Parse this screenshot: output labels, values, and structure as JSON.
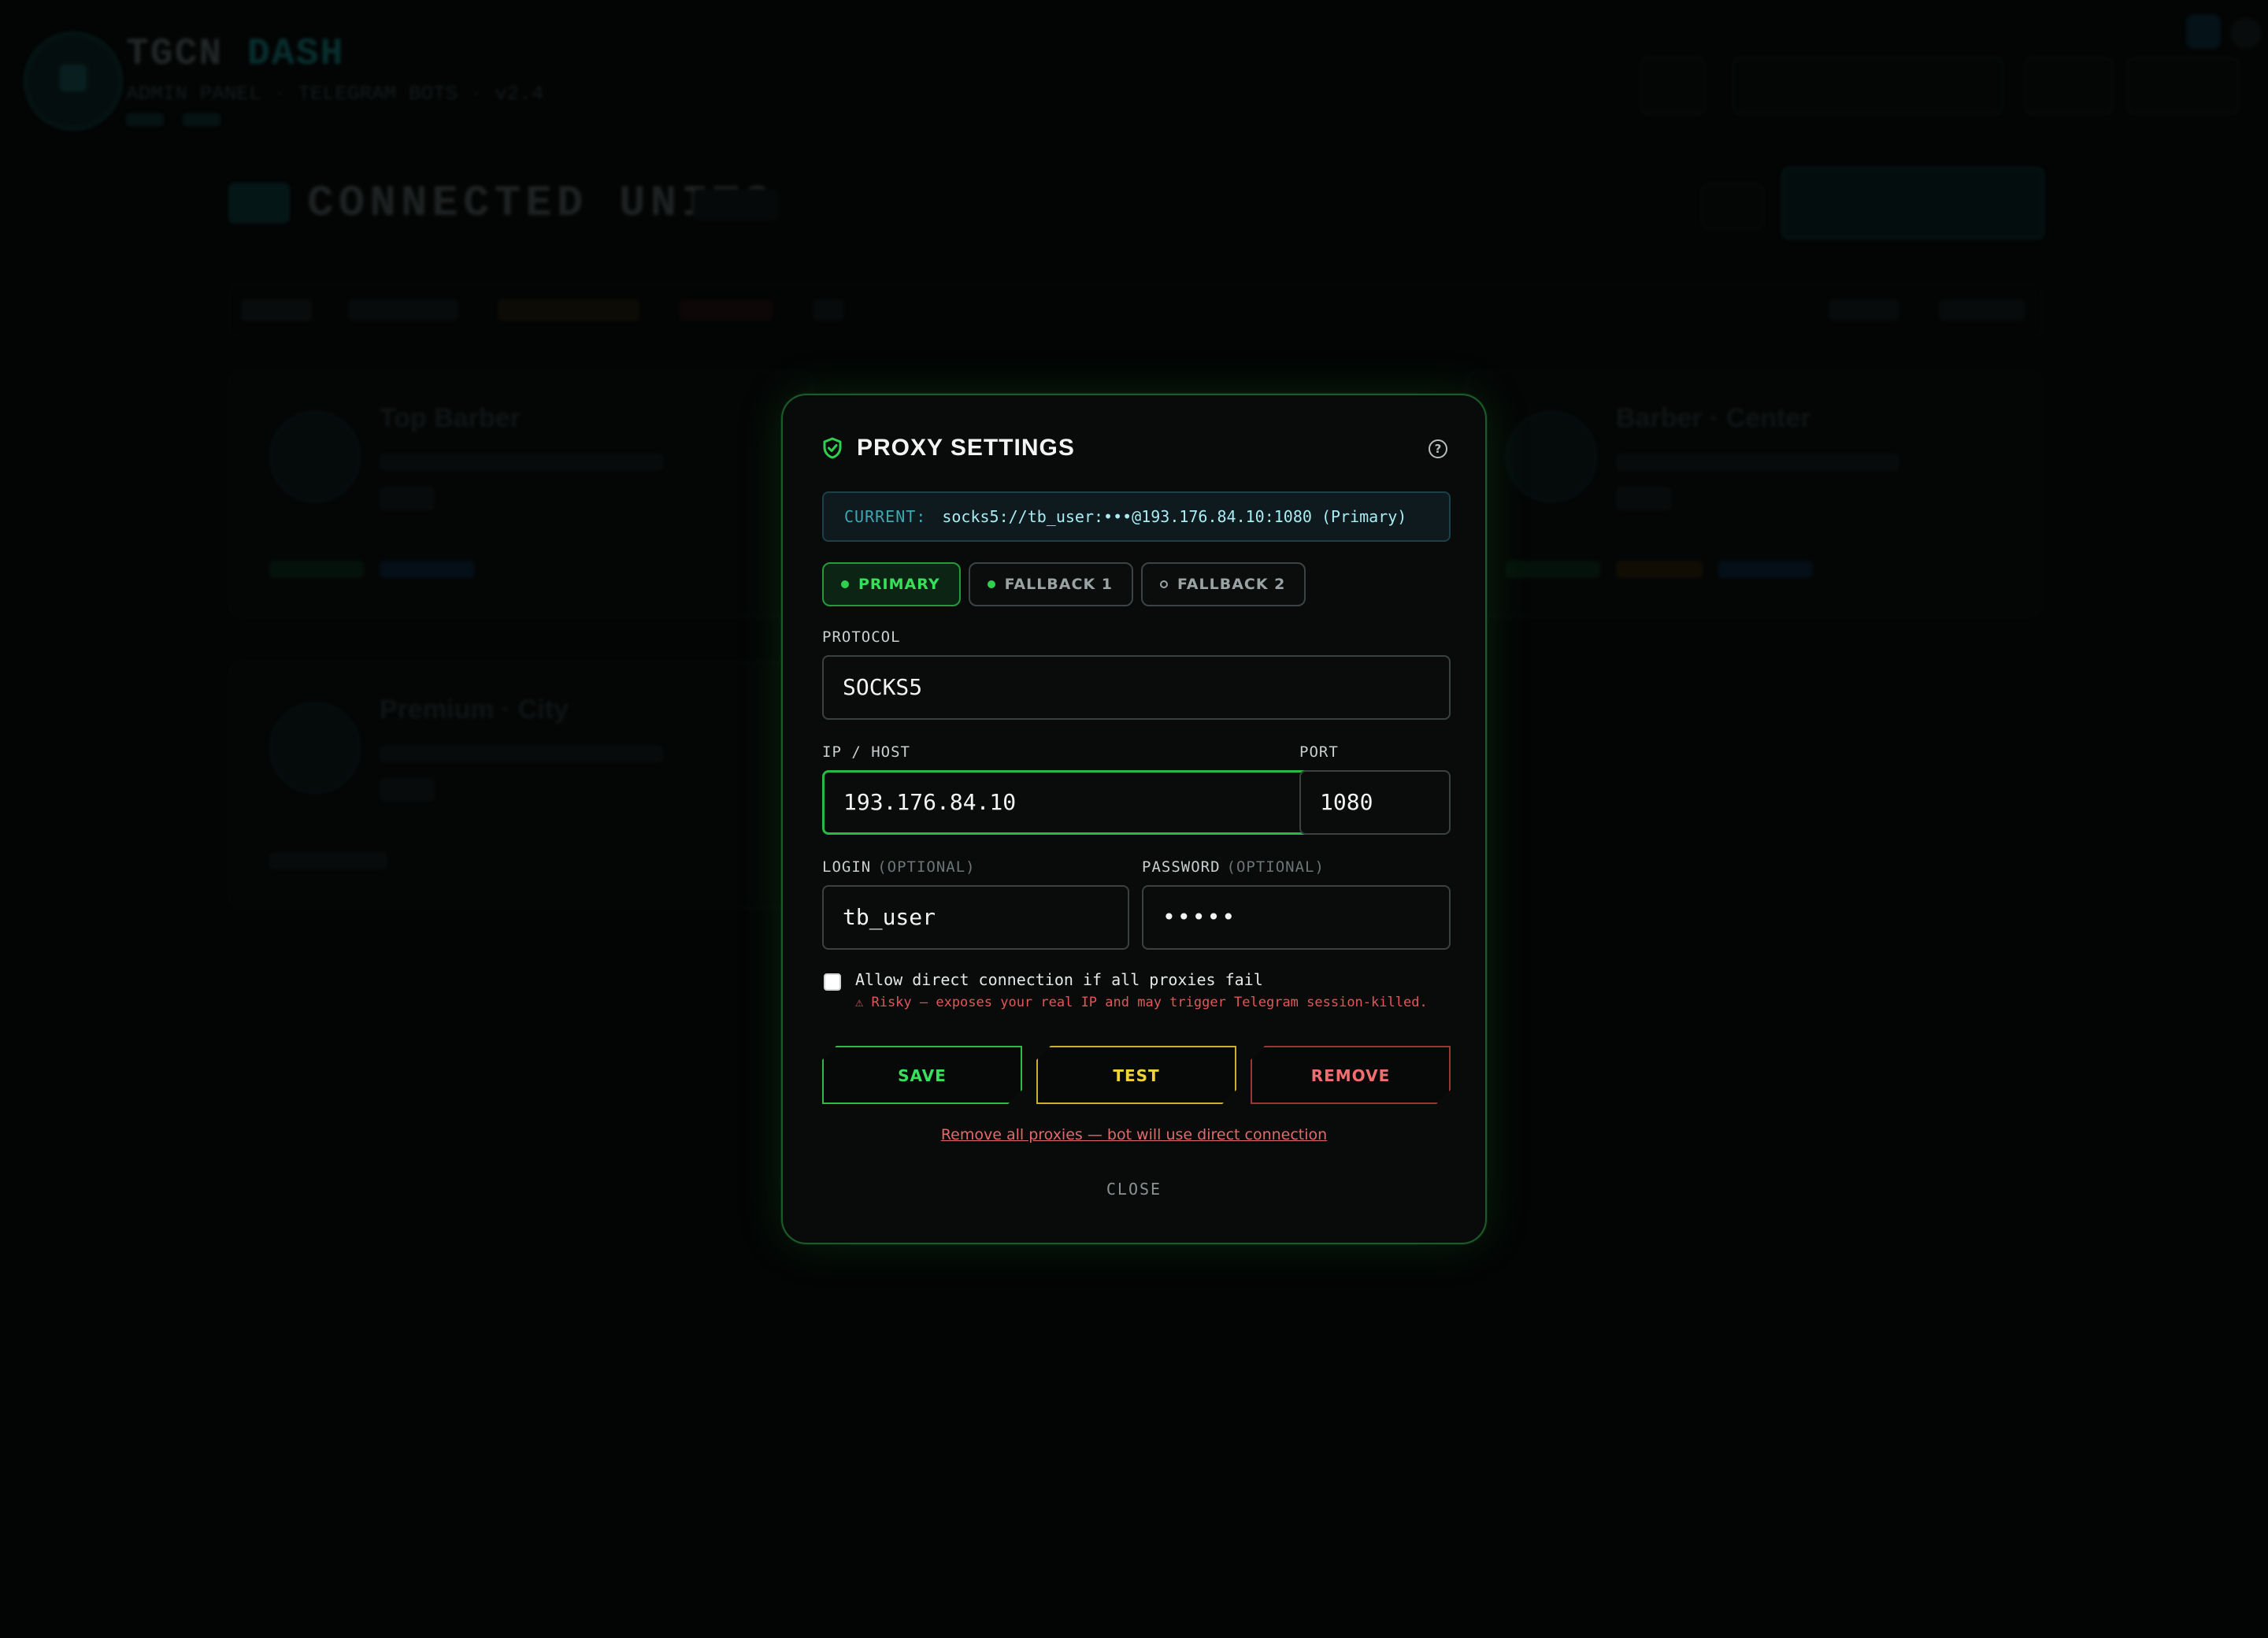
{
  "background": {
    "brand_primary": "TGCN",
    "brand_accent": "DASH",
    "brand_subtitle": "ADMIN PANEL · TELEGRAM BOTS · v2.4",
    "section_title": "CONNECTED UNITS",
    "cards": [
      {
        "name": "Top Barber"
      },
      {
        "name": "Barber · Center"
      },
      {
        "name": "Premium · City"
      }
    ]
  },
  "modal": {
    "title": "PROXY SETTINGS",
    "title_icon": "shield-check-icon",
    "help_icon": "help-circle-icon",
    "help_glyph": "?",
    "current": {
      "label": "CURRENT:",
      "value": "socks5://tb_user:•••@193.176.84.10:1080 (Primary)"
    },
    "tabs": [
      {
        "label": "PRIMARY",
        "state": "active"
      },
      {
        "label": "FALLBACK 1",
        "state": "configured"
      },
      {
        "label": "FALLBACK 2",
        "state": "empty"
      }
    ],
    "protocol": {
      "label": "PROTOCOL",
      "value": "SOCKS5"
    },
    "host": {
      "label": "IP / HOST",
      "value": "193.176.84.10"
    },
    "port": {
      "label": "PORT",
      "value": "1080"
    },
    "login": {
      "label": "LOGIN",
      "optional": "(OPTIONAL)",
      "value": "tb_user"
    },
    "password": {
      "label": "PASSWORD",
      "optional": "(OPTIONAL)",
      "value": "•••••"
    },
    "direct": {
      "label": "Allow direct connection if all proxies fail",
      "warning": "⚠ Risky — exposes your real IP and may trigger Telegram session-killed.",
      "checked": false
    },
    "buttons": {
      "save": "SAVE",
      "test": "TEST",
      "remove": "REMOVE"
    },
    "remove_all": "Remove all proxies — bot will use direct connection",
    "close": "CLOSE"
  },
  "colors": {
    "accent_green": "#2fd04f",
    "accent_yellow": "#f1d23a",
    "accent_red": "#ef6f6f",
    "accent_cyan": "#3fa7b2"
  }
}
